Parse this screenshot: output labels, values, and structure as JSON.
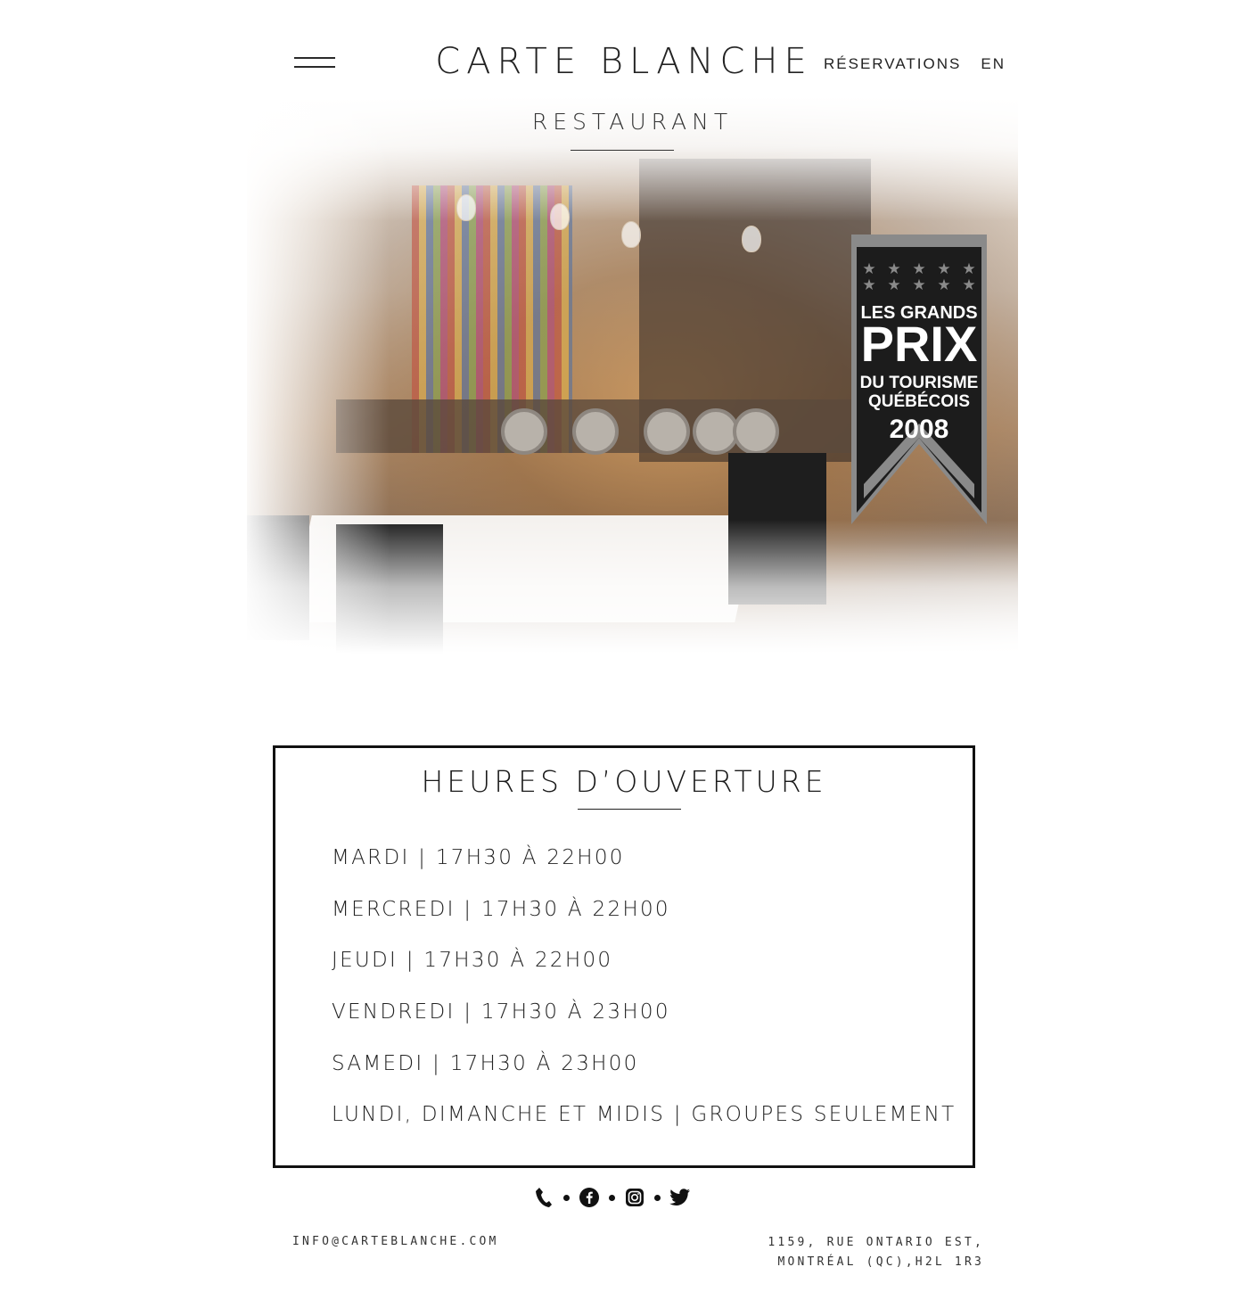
{
  "header": {
    "brand": "CARTE BLANCHE",
    "nav": {
      "reservations": "RÉSERVATIONS",
      "language": "EN"
    }
  },
  "hero": {
    "title": "RESTAURANT",
    "award": {
      "line1": "LES GRANDS",
      "line2": "PRIX",
      "line3": "DU TOURISME",
      "line4": "QUÉBÉCOIS",
      "year": "2008"
    }
  },
  "hours": {
    "title": "HEURES D’OUVERTURE",
    "rows": [
      "MARDI | 17H30 À 22H00",
      "MERCREDI | 17H30 À 22H00",
      "JEUDI | 17H30 À 22H00",
      "VENDREDI | 17H30 À 23H00",
      "SAMEDI | 17H30 À 23H00",
      "LUNDI, DIMANCHE ET MIDIS | GROUPES SEULEMENT"
    ]
  },
  "social": {
    "icons": [
      "phone-icon",
      "facebook-icon",
      "instagram-icon",
      "twitter-icon"
    ]
  },
  "footer": {
    "email": "INFO@CARTEBLANCHE.COM",
    "address_line1": "1159, RUE ONTARIO EST,",
    "address_line2": "MONTRÉAL (QC),H2L 1R3"
  },
  "colors": {
    "text": "#1a1a1a",
    "award_black": "#1c1c1c",
    "award_gray": "#8a8a8a"
  }
}
